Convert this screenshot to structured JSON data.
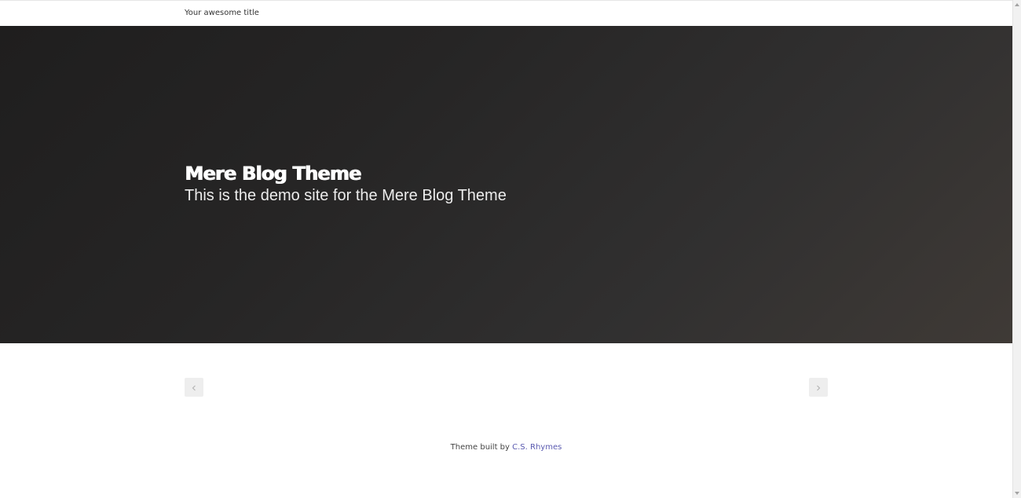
{
  "header": {
    "site_title": "Your awesome title"
  },
  "hero": {
    "title": "Mere Blog Theme",
    "subtitle": "This is the demo site for the Mere Blog Theme"
  },
  "pagination": {
    "prev_icon": "chevron-left-icon",
    "next_icon": "chevron-right-icon"
  },
  "footer": {
    "prefix": "Theme built by ",
    "author_link": "C.S. Rhymes"
  },
  "colors": {
    "hero_bg": "#262525",
    "link": "#5a5ab0",
    "pager_bg": "#eeeeee"
  }
}
